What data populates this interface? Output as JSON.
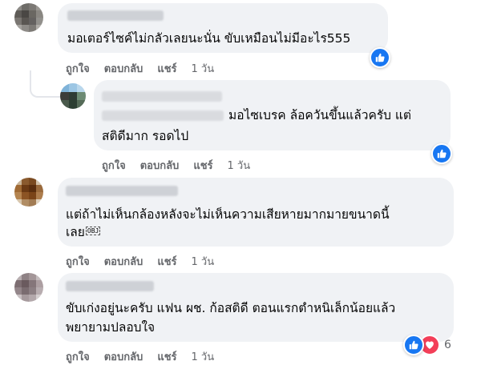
{
  "actions": {
    "like": "ถูกใจ",
    "reply": "ตอบกลับ",
    "share": "แชร์"
  },
  "comments": [
    {
      "text": "มอเตอร์ไซค์ไม่กลัวเลยนะนั่น ขับเหมือนไม่มีอะไร555",
      "time": "1 วัน",
      "reaction": "like"
    },
    {
      "lines": [
        "มอไซเบรค ล้อควันขึ้นแล้วครับ แต่",
        "สติดีมาก รอดไป"
      ],
      "time": "1 วัน",
      "reaction": "like"
    },
    {
      "lines": [
        "แต่ถ้าไม่เห็นกล้องหลังจะไม่เห็นความเสียหายมากมายขนาดนี้",
        "เลย"
      ],
      "obj_glyph": "OBJ",
      "time": "1 วัน"
    },
    {
      "lines": [
        "ขับเก่งอยู่นะครับ แฟน ผช. ก้อสติดี ตอนแรกตำหนิเล็กน้อยแล้ว",
        "พยายามปลอบใจ"
      ],
      "time": "1 วัน",
      "reaction_count": "6"
    }
  ],
  "colors": {
    "like": "#1877f2",
    "love": "#f33e58",
    "bubble": "#f0f2f5",
    "meta": "#65676b"
  },
  "icons": {
    "like": "thumbs-up-icon",
    "love": "heart-icon"
  }
}
